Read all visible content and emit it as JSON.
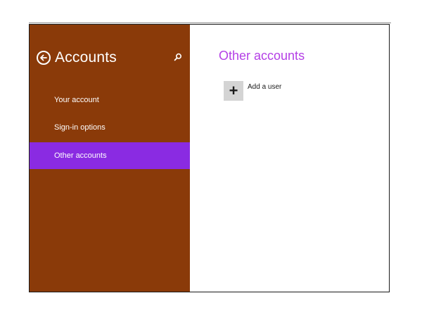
{
  "colors": {
    "sidebar_bg": "#8a3a09",
    "selected_item_bg": "#8a2be2",
    "content_title": "#b43fe6",
    "add_tile_bg": "#d4d4d4"
  },
  "sidebar": {
    "back_icon": "back-arrow-icon",
    "title": "Accounts",
    "search_icon": "search-icon",
    "items": [
      {
        "label": "Your account",
        "selected": false
      },
      {
        "label": "Sign-in options",
        "selected": false
      },
      {
        "label": "Other accounts",
        "selected": true
      }
    ]
  },
  "content": {
    "title": "Other accounts",
    "add_user": {
      "icon": "plus-icon",
      "label": "Add a user"
    }
  }
}
